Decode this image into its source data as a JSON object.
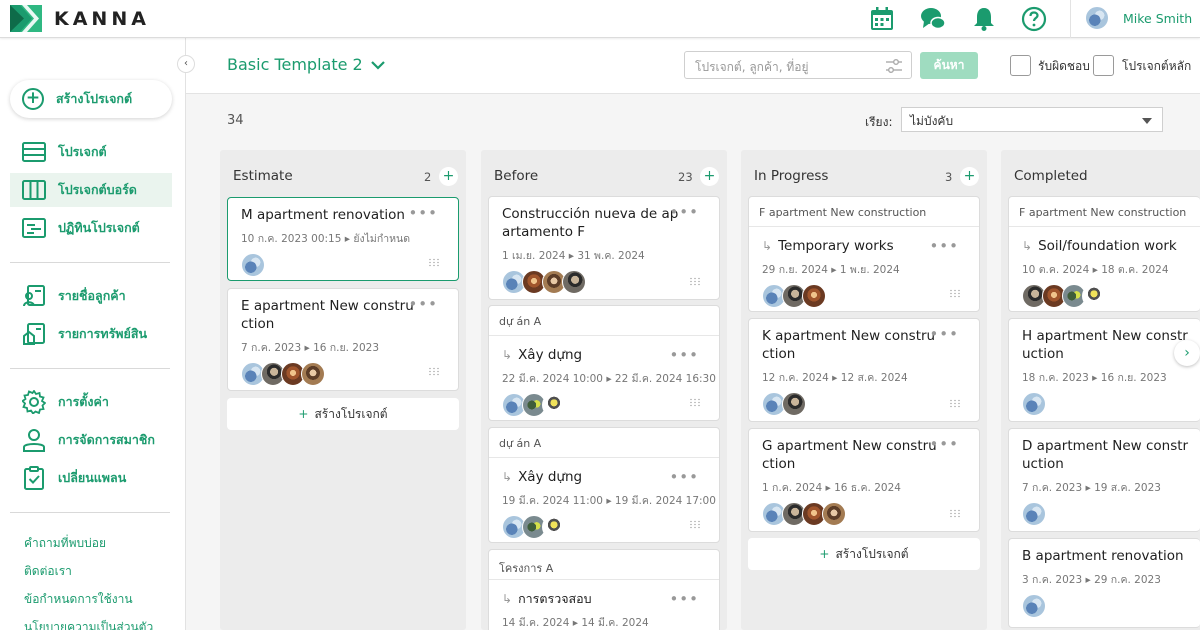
{
  "brand": {
    "name": "KANNA",
    "accent": "#1b9b6e"
  },
  "header": {
    "icons": [
      "calendar-icon",
      "chat-icon",
      "bell-icon",
      "help-icon"
    ],
    "user_name": "Mike Smith"
  },
  "sidebar": {
    "create_label": "สร้างโปรเจกต์",
    "items": [
      {
        "label": "โปรเจกต์",
        "icon": "list-icon"
      },
      {
        "label": "โปรเจกต์บอร์ด",
        "icon": "board-icon"
      },
      {
        "label": "ปฏิทินโปรเจกต์",
        "icon": "calendar-list-icon"
      },
      {
        "label": "รายชื่อลูกค้า",
        "icon": "customer-icon"
      },
      {
        "label": "รายการทรัพย์สิน",
        "icon": "property-icon"
      },
      {
        "label": "การตั้งค่า",
        "icon": "gear-icon"
      },
      {
        "label": "การจัดการสมาชิก",
        "icon": "member-icon"
      },
      {
        "label": "เปลี่ยนแพลน",
        "icon": "plan-icon"
      }
    ],
    "footer_links": [
      "คำถามที่พบบ่อย",
      "ติดต่อเรา",
      "ข้อกำหนดการใช้งาน",
      "นโยบายความเป็นส่วนตัว"
    ]
  },
  "toolbar": {
    "template_name": "Basic Template 2",
    "search_placeholder": "โปรเจกต์, ลูกค้า, ที่อยู่",
    "search_button": "ค้นหา",
    "check_responsible": "รับผิดชอบ",
    "check_main": "โปรเจกต์หลัก"
  },
  "board": {
    "total_count": "34",
    "sort_label": "เรียง:",
    "sort_value": "ไม่บังคับ",
    "add_project_label": "สร้างโปรเจกต์",
    "columns": [
      {
        "name": "Estimate",
        "count": "2",
        "cards": [
          {
            "title": "M apartment renovation",
            "dates": "10 ก.ค. 2023 00:15 ▸ ยังไม่กำหนด"
          },
          {
            "title": "E apartment New construction",
            "dates": "7 ก.ค. 2023 ▸ 16 ก.ย. 2023"
          }
        ]
      },
      {
        "name": "Before",
        "count": "23",
        "cards": [
          {
            "title": "Construcción nueva de apartamento F",
            "dates": "1 เม.ย. 2024 ▸ 31 พ.ค. 2024"
          },
          {
            "parent": "dự án A",
            "title": "Xây dựng",
            "dates": "22 มี.ค. 2024 10:00 ▸ 22 มี.ค. 2024 16:30"
          },
          {
            "parent": "dự án A",
            "title": "Xây dựng",
            "dates": "19 มี.ค. 2024 11:00 ▸ 19 มี.ค. 2024 17:00"
          },
          {
            "parent": "โครงการ A",
            "title": "การตรวจสอบ",
            "dates": "14 มี.ค. 2024 ▸ 14 มี.ค. 2024"
          }
        ]
      },
      {
        "name": "In Progress",
        "count": "3",
        "cards": [
          {
            "parent": "F apartment New construction",
            "title": "Temporary works",
            "dates": "29 ก.ย. 2024 ▸ 1 พ.ย. 2024"
          },
          {
            "title": "K apartment New construction",
            "dates": "12 ก.ค. 2024 ▸ 12 ส.ค. 2024"
          },
          {
            "title": "G apartment New construction",
            "dates": "1 ก.ค. 2024 ▸ 16 ธ.ค. 2024"
          }
        ]
      },
      {
        "name": "Completed",
        "count": "",
        "cards": [
          {
            "parent": "F apartment New construction",
            "title": "Soil/foundation work",
            "dates": "10 ต.ค. 2024 ▸ 18 ต.ค. 2024"
          },
          {
            "title": "H apartment New construction",
            "dates": "18 ก.ค. 2023 ▸ 16 ก.ย. 2023"
          },
          {
            "title": "D apartment New construction",
            "dates": "7 ก.ค. 2023 ▸ 19 ส.ค. 2023"
          },
          {
            "title": "B apartment renovation",
            "dates": "3 ก.ค. 2023 ▸ 29 ก.ค. 2023"
          }
        ]
      }
    ]
  }
}
